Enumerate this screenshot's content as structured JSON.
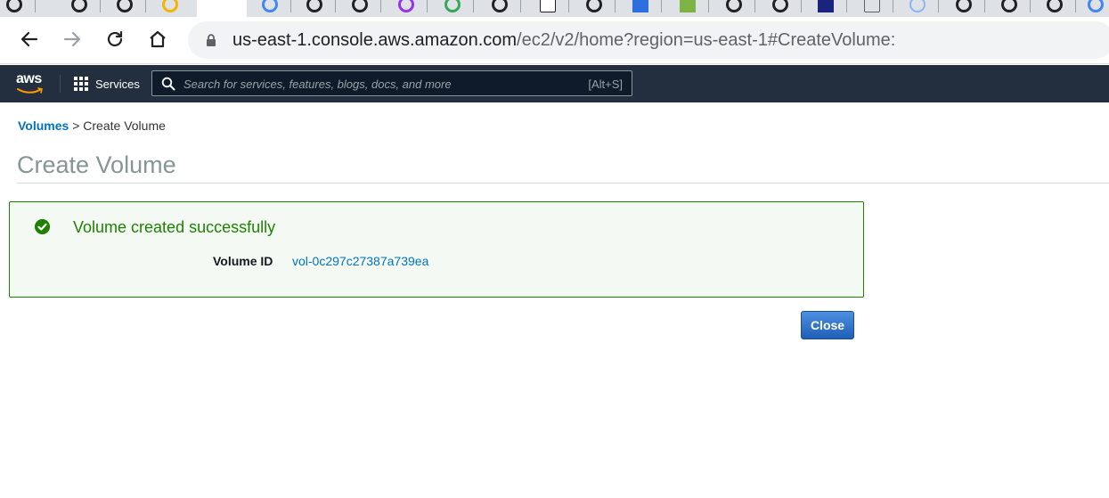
{
  "browser": {
    "url_host": "us-east-1.console.aws.amazon.com",
    "url_path": "/ec2/v2/home?region=us-east-1#CreateVolume:"
  },
  "aws_header": {
    "logo_text": "aws",
    "services_label": "Services",
    "search_placeholder": "Search for services, features, blogs, docs, and more",
    "search_shortcut": "[Alt+S]"
  },
  "breadcrumb": {
    "parent_label": "Volumes",
    "separator": ">",
    "current_label": "Create Volume"
  },
  "page": {
    "title": "Create Volume"
  },
  "alert": {
    "message": "Volume created successfully",
    "volume_id_label": "Volume ID",
    "volume_id_value": "vol-0c297c27387a739ea"
  },
  "actions": {
    "close_label": "Close"
  },
  "colors": {
    "aws_navbar": "#232f3e",
    "success_green": "#1d8102",
    "link_blue": "#0073bb",
    "primary_button": "#2e73c9"
  }
}
